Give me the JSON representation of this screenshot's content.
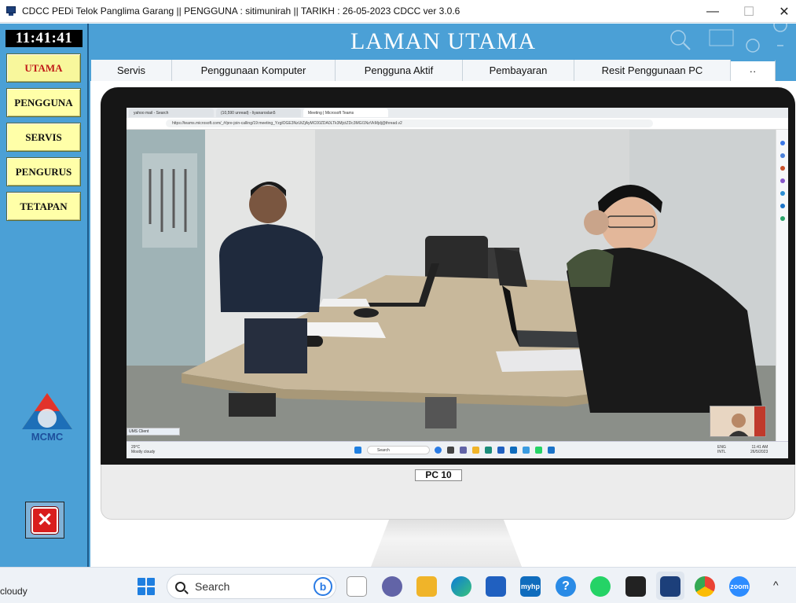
{
  "window": {
    "title": "CDCC PEDi Telok Panglima Garang || PENGGUNA : sitimunirah || TARIKH : 26-05-2023 CDCC ver 3.0.6",
    "minimize": "—",
    "maximize": "☐",
    "close": "✕"
  },
  "sidebar": {
    "clock": "11:41:41",
    "items": [
      {
        "label": "UTAMA",
        "active": true
      },
      {
        "label": "PENGGUNA",
        "active": false
      },
      {
        "label": "SERVIS",
        "active": false
      },
      {
        "label": "PENGURUS",
        "active": false
      },
      {
        "label": "TETAPAN",
        "active": false
      }
    ],
    "logo_text": "MCMC"
  },
  "header": {
    "title": "LAMAN UTAMA"
  },
  "tabs": [
    {
      "label": "Servis"
    },
    {
      "label": "Penggunaan Komputer"
    },
    {
      "label": "Pengguna Aktif"
    },
    {
      "label": "Pembayaran"
    },
    {
      "label": "Resit Penggunaan PC"
    },
    {
      "label": "··"
    }
  ],
  "monitor": {
    "pc_label": "PC 10",
    "browser": {
      "tabs": [
        {
          "label": "yahoo mail - Search"
        },
        {
          "label": "(10,590 unread) - liyanaroslan5"
        },
        {
          "label": "Meeting | Microsoft Teams"
        }
      ],
      "address": "https://teams.microsoft.com/_#/pre-join-calling/19:meeting_YzglOGE3NzUtZjAyMC00ZDA0LTk3MjctZDc3MGI1NzVkMjdj@thread.v2"
    },
    "ums_label": "UMS Client",
    "inner_taskbar": {
      "weather_temp": "29°C",
      "weather_desc": "Mostly cloudy",
      "search": "Search",
      "lang_1": "ENG",
      "lang_2": "INTL",
      "time": "11:41 AM",
      "date": "26/5/2023"
    }
  },
  "taskbar": {
    "weather": "cloudy",
    "search_placeholder": "Search",
    "bing_label": "b",
    "myhp_label": "myhp",
    "zoom_label": "zoom",
    "tray_chevron": "^"
  }
}
